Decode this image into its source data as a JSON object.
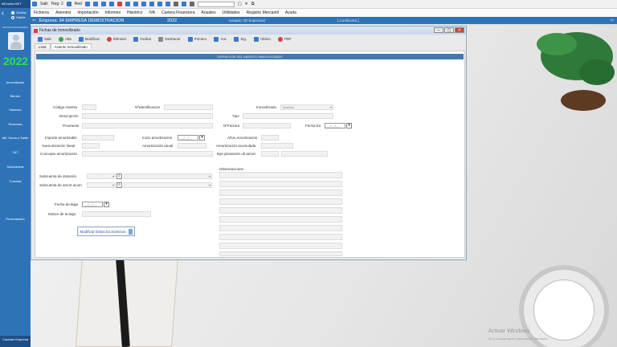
{
  "sidebar": {
    "logo": "diEconta NET",
    "user": "ARTICULO/CONTABLE",
    "year": "2022",
    "items": [
      "Inmovilizado",
      "Bienes",
      "Histórico",
      "Reservas",
      "Mtr. Suma y Saldo",
      "347",
      "Subcuentas",
      "Cuentas",
      "Presentación"
    ],
    "bottom": "Cambiar Empresa"
  },
  "radios": {
    "ocultar": "Ocultar",
    "visible": "Visible"
  },
  "topbar": {
    "salir": "Salir",
    "reg": "Reg: 2",
    "red": "Red",
    "window_icons": [
      "▢",
      "✕",
      "⧉"
    ]
  },
  "menu": [
    "Ficheros",
    "Asientos",
    "Importación",
    "Informes",
    "Histórico",
    "IVA",
    "Cartera Financiera",
    "Anuales",
    "Utilidades",
    "Registro Mercantil",
    "Ayuda"
  ],
  "empresa": {
    "label": "Empresa: 94  EMPRESA DEMOSTRACION",
    "year": "2022",
    "usuario": "Usuario: 00  Supervisor",
    "cuenta": "[ Conficonta ]"
  },
  "dialog": {
    "title": "Fichas de Inmovilizado",
    "toolbar": [
      "Salir",
      "Alta",
      "Modificar",
      "Eliminar",
      "Grabar",
      "Deshacer",
      "Primero",
      "Ant.",
      "Sig.",
      "Último",
      "PDF"
    ],
    "tabs": [
      "Lista",
      "Asiento Inmovilizado"
    ],
    "header": "DEFINICION DEL ASIENTO INMOVILIZABLE",
    "fields": {
      "codigo_asiento": "Código Asiento",
      "nidentificacion": "NºIdentificación",
      "inmovilizado": "Inmovilizado",
      "inmovilizado_value": "Material",
      "descripcion": "Descripción",
      "tipo": "Tipo",
      "proveedor": "Proveedor",
      "nfactura": "NºFactura",
      "fecha_fra": "Fecha fra",
      "importe_amortizable": "Importe amortizable",
      "inicio_amortizacion": "Inicio amortización",
      "anos_amortizacion": "Años Amortización",
      "pct_amortizacion_lineal": "%amortización lineal",
      "amortizacion_anual": "Amortización anual",
      "amortizacion_acumulada": "Amortización acumulada",
      "concepto_amortizacion": "Concepto amortización",
      "ejer_dotacion": "Ejer.yDotación ult amort.",
      "observaciones": "Observaciones",
      "subcuenta_dotacion": "Subcuenta de dotación",
      "subcuenta_amort": "Subcuenta de amort acum",
      "fecha_baja": "Fecha de Baja",
      "motivo_baja": "Motivo de la baja",
      "date_placeholder": "__/__/__"
    },
    "modify_button": "Modificar Datos Económicos"
  },
  "watermark": {
    "line1": "Activar Windows",
    "line2": "Ve a Configuración para activar Windows."
  }
}
